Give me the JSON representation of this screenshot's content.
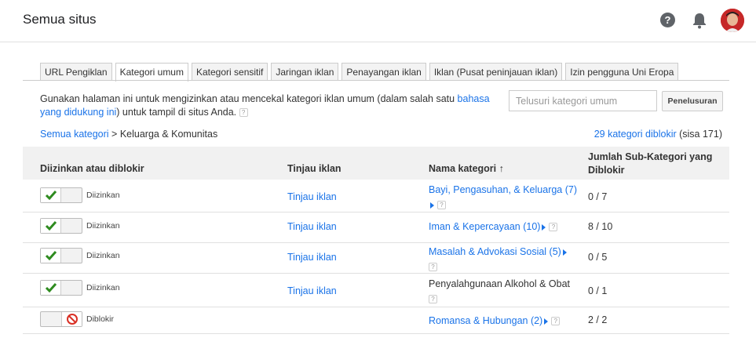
{
  "header": {
    "title": "Semua situs",
    "help_glyph": "?"
  },
  "tabs": [
    {
      "label": "URL Pengiklan",
      "active": false
    },
    {
      "label": "Kategori umum",
      "active": true
    },
    {
      "label": "Kategori sensitif",
      "active": false
    },
    {
      "label": "Jaringan iklan",
      "active": false
    },
    {
      "label": "Penayangan iklan",
      "active": false
    },
    {
      "label": "Iklan (Pusat peninjauan iklan)",
      "active": false
    },
    {
      "label": "Izin pengguna Uni Eropa",
      "active": false
    }
  ],
  "description": {
    "part1": "Gunakan halaman ini untuk mengizinkan atau mencekal kategori iklan umum (dalam salah satu ",
    "link": "bahasa yang didukung ini",
    "part2": ") untuk tampil di situs Anda. ",
    "help_glyph": "?"
  },
  "search": {
    "placeholder": "Telusuri kategori umum",
    "button": "Penelusuran"
  },
  "breadcrumb": {
    "root": "Semua kategori",
    "separator": " > ",
    "current": "Keluarga & Komunitas"
  },
  "blocked_summary": {
    "link": "29 kategori diblokir",
    "rest": " (sisa 171)"
  },
  "table": {
    "headers": {
      "status": "Diizinkan atau diblokir",
      "review": "Tinjau iklan",
      "name": "Nama kategori ↑",
      "subcount": "Jumlah Sub-Kategori yang Diblokir"
    },
    "rows": [
      {
        "status": "Diizinkan",
        "review": "Tinjau iklan",
        "name": "Bayi, Pengasuhan, & Keluarga (7)",
        "linked": true,
        "count": "0 / 7"
      },
      {
        "status": "Diizinkan",
        "review": "Tinjau iklan",
        "name": "Iman & Kepercayaan (10)",
        "linked": true,
        "count": "8 / 10"
      },
      {
        "status": "Diizinkan",
        "review": "Tinjau iklan",
        "name": "Masalah & Advokasi Sosial (5)",
        "linked": true,
        "count": "0 / 5"
      },
      {
        "status": "Diizinkan",
        "review": "Tinjau iklan",
        "name": "Penyalahgunaan Alkohol & Obat",
        "linked": false,
        "count": "0 / 1"
      },
      {
        "status": "Diblokir",
        "review": "",
        "name": "Romansa & Hubungan (2)",
        "linked": true,
        "count": "2 / 2"
      }
    ]
  },
  "colors": {
    "link": "#1a73e8",
    "allowed_check": "#2e8b1f",
    "blocked": "#d93025",
    "avatar": "#c62828"
  },
  "icons": {
    "help": "help-circle-icon",
    "notifications": "bell-icon",
    "allowed": "checkmark-icon",
    "blocked": "block-icon",
    "expand": "triangle-right-icon"
  }
}
